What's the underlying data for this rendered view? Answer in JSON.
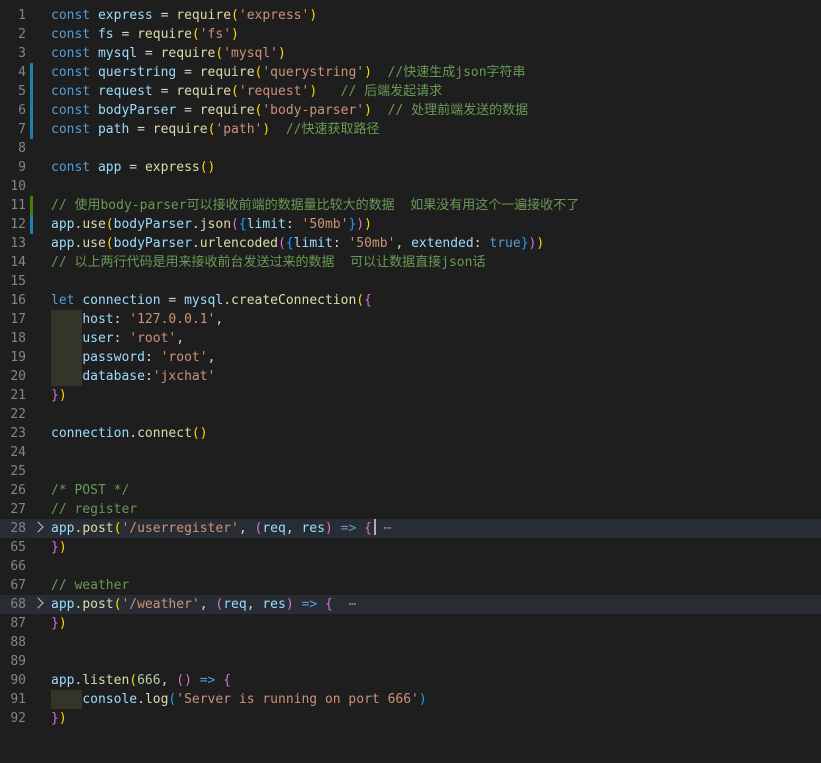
{
  "editor": {
    "lines": [
      {
        "n": "1",
        "tokens": [
          [
            "kw",
            "const "
          ],
          [
            "var",
            "express"
          ],
          [
            "pl",
            " = "
          ],
          [
            "fn",
            "require"
          ],
          [
            "b1",
            "("
          ],
          [
            "str",
            "'express'"
          ],
          [
            "b1",
            ")"
          ]
        ]
      },
      {
        "n": "2",
        "tokens": [
          [
            "kw",
            "const "
          ],
          [
            "var",
            "fs"
          ],
          [
            "pl",
            " = "
          ],
          [
            "fn",
            "require"
          ],
          [
            "b1",
            "("
          ],
          [
            "str",
            "'fs'"
          ],
          [
            "b1",
            ")"
          ]
        ]
      },
      {
        "n": "3",
        "tokens": [
          [
            "kw",
            "const "
          ],
          [
            "var",
            "mysql"
          ],
          [
            "pl",
            " = "
          ],
          [
            "fn",
            "require"
          ],
          [
            "b1",
            "("
          ],
          [
            "str",
            "'mysql'"
          ],
          [
            "b1",
            ")"
          ]
        ]
      },
      {
        "n": "4",
        "gutter": "mod",
        "tokens": [
          [
            "kw",
            "const "
          ],
          [
            "var",
            "querstring"
          ],
          [
            "pl",
            " = "
          ],
          [
            "fn",
            "require"
          ],
          [
            "b1",
            "("
          ],
          [
            "str",
            "'querystring'"
          ],
          [
            "b1",
            ")"
          ],
          [
            "pl",
            "  "
          ],
          [
            "com",
            "//快速生成json字符串"
          ]
        ]
      },
      {
        "n": "5",
        "gutter": "mod",
        "tokens": [
          [
            "kw",
            "const "
          ],
          [
            "var",
            "request"
          ],
          [
            "pl",
            " = "
          ],
          [
            "fn",
            "require"
          ],
          [
            "b1",
            "("
          ],
          [
            "str",
            "'request'"
          ],
          [
            "b1",
            ")"
          ],
          [
            "pl",
            "   "
          ],
          [
            "com",
            "// 后端发起请求"
          ]
        ]
      },
      {
        "n": "6",
        "gutter": "mod",
        "tokens": [
          [
            "kw",
            "const "
          ],
          [
            "var",
            "bodyParser"
          ],
          [
            "pl",
            " = "
          ],
          [
            "fn",
            "require"
          ],
          [
            "b1",
            "("
          ],
          [
            "str",
            "'body-parser'"
          ],
          [
            "b1",
            ")"
          ],
          [
            "pl",
            "  "
          ],
          [
            "com",
            "// 处理前端发送的数据"
          ]
        ]
      },
      {
        "n": "7",
        "gutter": "mod",
        "tokens": [
          [
            "kw",
            "const "
          ],
          [
            "var",
            "path"
          ],
          [
            "pl",
            " = "
          ],
          [
            "fn",
            "require"
          ],
          [
            "b1",
            "("
          ],
          [
            "str",
            "'path'"
          ],
          [
            "b1",
            ")"
          ],
          [
            "pl",
            "  "
          ],
          [
            "com",
            "//快速获取路径"
          ]
        ]
      },
      {
        "n": "8",
        "tokens": []
      },
      {
        "n": "9",
        "tokens": [
          [
            "kw",
            "const "
          ],
          [
            "var",
            "app"
          ],
          [
            "pl",
            " = "
          ],
          [
            "fn",
            "express"
          ],
          [
            "b1",
            "()"
          ]
        ]
      },
      {
        "n": "10",
        "tokens": []
      },
      {
        "n": "11",
        "gutter": "add",
        "tokens": [
          [
            "com",
            "// 使用body-parser可以接收前端的数据量比较大的数据  如果没有用这个一遍接收不了"
          ]
        ]
      },
      {
        "n": "12",
        "gutter": "mod",
        "tokens": [
          [
            "var",
            "app"
          ],
          [
            "pl",
            "."
          ],
          [
            "fn",
            "use"
          ],
          [
            "b1",
            "("
          ],
          [
            "var",
            "bodyParser"
          ],
          [
            "pl",
            "."
          ],
          [
            "fn",
            "json"
          ],
          [
            "b2",
            "("
          ],
          [
            "b3",
            "{"
          ],
          [
            "var",
            "limit"
          ],
          [
            "pl",
            ": "
          ],
          [
            "str",
            "'50mb'"
          ],
          [
            "b3",
            "}"
          ],
          [
            "b2",
            ")"
          ],
          [
            "b1",
            ")"
          ]
        ]
      },
      {
        "n": "13",
        "tokens": [
          [
            "var",
            "app"
          ],
          [
            "pl",
            "."
          ],
          [
            "fn",
            "use"
          ],
          [
            "b1",
            "("
          ],
          [
            "var",
            "bodyParser"
          ],
          [
            "pl",
            "."
          ],
          [
            "fn",
            "urlencoded"
          ],
          [
            "b2",
            "("
          ],
          [
            "b3",
            "{"
          ],
          [
            "var",
            "limit"
          ],
          [
            "pl",
            ": "
          ],
          [
            "str",
            "'50mb'"
          ],
          [
            "pl",
            ", "
          ],
          [
            "var",
            "extended"
          ],
          [
            "pl",
            ": "
          ],
          [
            "kw",
            "true"
          ],
          [
            "b3",
            "}"
          ],
          [
            "b2",
            ")"
          ],
          [
            "b1",
            ")"
          ]
        ]
      },
      {
        "n": "14",
        "tokens": [
          [
            "com",
            "// 以上两行代码是用来接收前台发送过来的数据  可以让数据直接json话"
          ]
        ]
      },
      {
        "n": "15",
        "tokens": []
      },
      {
        "n": "16",
        "tokens": [
          [
            "kw",
            "let "
          ],
          [
            "var",
            "connection"
          ],
          [
            "pl",
            " = "
          ],
          [
            "var",
            "mysql"
          ],
          [
            "pl",
            "."
          ],
          [
            "fn",
            "createConnection"
          ],
          [
            "b1",
            "("
          ],
          [
            "b2",
            "{"
          ]
        ]
      },
      {
        "n": "17",
        "indent": true,
        "tokens": [
          [
            "pl",
            "    "
          ],
          [
            "var",
            "host"
          ],
          [
            "pl",
            ": "
          ],
          [
            "str",
            "'127.0.0.1'"
          ],
          [
            "pl",
            ","
          ]
        ]
      },
      {
        "n": "18",
        "indent": true,
        "tokens": [
          [
            "pl",
            "    "
          ],
          [
            "var",
            "user"
          ],
          [
            "pl",
            ": "
          ],
          [
            "str",
            "'root'"
          ],
          [
            "pl",
            ","
          ]
        ]
      },
      {
        "n": "19",
        "indent": true,
        "tokens": [
          [
            "pl",
            "    "
          ],
          [
            "var",
            "password"
          ],
          [
            "pl",
            ": "
          ],
          [
            "str",
            "'root'"
          ],
          [
            "pl",
            ","
          ]
        ]
      },
      {
        "n": "20",
        "indent": true,
        "tokens": [
          [
            "pl",
            "    "
          ],
          [
            "var",
            "database"
          ],
          [
            "pl",
            ":"
          ],
          [
            "str",
            "'jxchat'"
          ]
        ]
      },
      {
        "n": "21",
        "tokens": [
          [
            "b2",
            "}"
          ],
          [
            "b1",
            ")"
          ]
        ]
      },
      {
        "n": "22",
        "tokens": []
      },
      {
        "n": "23",
        "tokens": [
          [
            "var",
            "connection"
          ],
          [
            "pl",
            "."
          ],
          [
            "fn",
            "connect"
          ],
          [
            "b1",
            "()"
          ]
        ]
      },
      {
        "n": "24",
        "tokens": []
      },
      {
        "n": "25",
        "tokens": []
      },
      {
        "n": "26",
        "tokens": [
          [
            "com",
            "/* POST */"
          ]
        ]
      },
      {
        "n": "27",
        "tokens": [
          [
            "com",
            "// register"
          ]
        ]
      },
      {
        "n": "28",
        "fold": true,
        "current": true,
        "tokens": [
          [
            "var",
            "app"
          ],
          [
            "pl",
            "."
          ],
          [
            "fn",
            "post"
          ],
          [
            "b1",
            "("
          ],
          [
            "str",
            "'/userregister'"
          ],
          [
            "pl",
            ", "
          ],
          [
            "b2",
            "("
          ],
          [
            "var",
            "req"
          ],
          [
            "pl",
            ", "
          ],
          [
            "var",
            "res"
          ],
          [
            "b2",
            ")"
          ],
          [
            "pl",
            " "
          ],
          [
            "kw",
            "=>"
          ],
          [
            "pl",
            " "
          ],
          [
            "b2",
            "{"
          ],
          [
            "cursor",
            ""
          ],
          [
            "ell",
            " ⋯"
          ]
        ]
      },
      {
        "n": "65",
        "tokens": [
          [
            "b2",
            "}"
          ],
          [
            "b1",
            ")"
          ]
        ]
      },
      {
        "n": "66",
        "tokens": []
      },
      {
        "n": "67",
        "tokens": [
          [
            "com",
            "// weather"
          ]
        ]
      },
      {
        "n": "68",
        "fold": true,
        "current": true,
        "tokens": [
          [
            "var",
            "app"
          ],
          [
            "pl",
            "."
          ],
          [
            "fn",
            "post"
          ],
          [
            "b1",
            "("
          ],
          [
            "str",
            "'/weather'"
          ],
          [
            "pl",
            ", "
          ],
          [
            "b2",
            "("
          ],
          [
            "var",
            "req"
          ],
          [
            "pl",
            ", "
          ],
          [
            "var",
            "res"
          ],
          [
            "b2",
            ")"
          ],
          [
            "pl",
            " "
          ],
          [
            "kw",
            "=>"
          ],
          [
            "pl",
            " "
          ],
          [
            "b2",
            "{"
          ],
          [
            "ell",
            "  ⋯"
          ]
        ]
      },
      {
        "n": "87",
        "tokens": [
          [
            "b2",
            "}"
          ],
          [
            "b1",
            ")"
          ]
        ]
      },
      {
        "n": "88",
        "tokens": []
      },
      {
        "n": "89",
        "tokens": []
      },
      {
        "n": "90",
        "tokens": [
          [
            "var",
            "app"
          ],
          [
            "pl",
            "."
          ],
          [
            "fn",
            "listen"
          ],
          [
            "b1",
            "("
          ],
          [
            "num",
            "666"
          ],
          [
            "pl",
            ", "
          ],
          [
            "b2",
            "()"
          ],
          [
            "pl",
            " "
          ],
          [
            "kw",
            "=>"
          ],
          [
            "pl",
            " "
          ],
          [
            "b2",
            "{"
          ]
        ]
      },
      {
        "n": "91",
        "indent": true,
        "tokens": [
          [
            "pl",
            "    "
          ],
          [
            "var",
            "console"
          ],
          [
            "pl",
            "."
          ],
          [
            "fn",
            "log"
          ],
          [
            "b3",
            "("
          ],
          [
            "str",
            "'Server is running on port 666'"
          ],
          [
            "b3",
            ")"
          ]
        ]
      },
      {
        "n": "92",
        "tokens": [
          [
            "b2",
            "}"
          ],
          [
            "b1",
            ")"
          ]
        ]
      }
    ]
  }
}
